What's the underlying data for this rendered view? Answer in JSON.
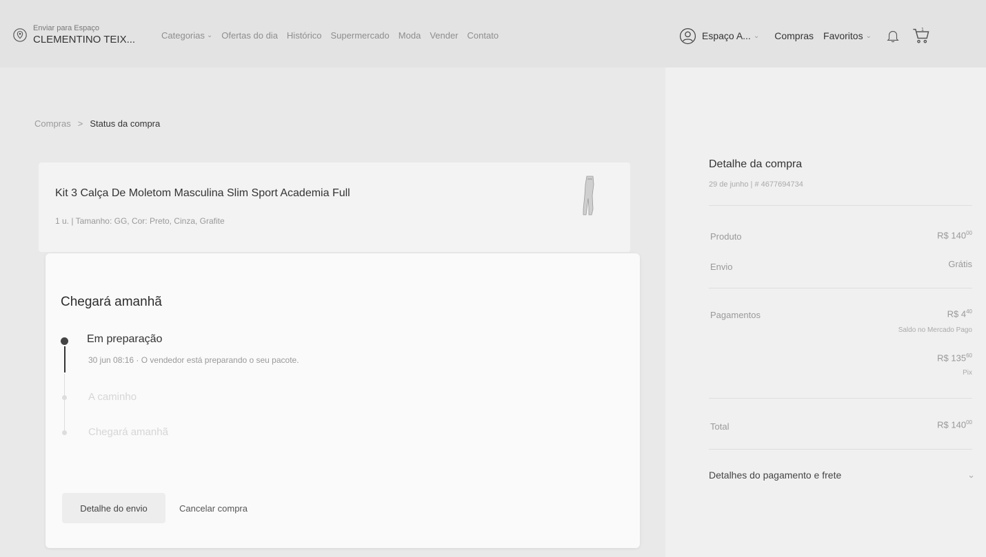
{
  "header": {
    "location_small": "Enviar para Espaço",
    "location_big": "CLEMENTINO TEIX...",
    "nav": [
      {
        "label": "Categorias",
        "dropdown": true
      },
      {
        "label": "Ofertas do dia"
      },
      {
        "label": "Histórico"
      },
      {
        "label": "Supermercado"
      },
      {
        "label": "Moda"
      },
      {
        "label": "Vender"
      },
      {
        "label": "Contato"
      }
    ],
    "account_label": "Espaço A...",
    "purchases_label": "Compras",
    "favorites_label": "Favoritos"
  },
  "breadcrumb": {
    "parent": "Compras",
    "separator": ">",
    "current": "Status da compra"
  },
  "product": {
    "title": "Kit 3 Calça De Moletom Masculina Slim Sport Academia Full",
    "details": "1 u. | Tamanho: GG, Cor: Preto, Cinza, Grafite"
  },
  "status": {
    "title": "Chegará amanhã",
    "steps": [
      {
        "label": "Em preparação",
        "desc": "30 jun 08:16 · O vendedor está preparando o seu pacote.",
        "active": true
      },
      {
        "label": "A caminho",
        "active": false
      },
      {
        "label": "Chegará amanhã",
        "active": false
      }
    ],
    "detail_button": "Detalhe do envio",
    "cancel_button": "Cancelar compra"
  },
  "summary": {
    "title": "Detalhe da compra",
    "subtitle": "29 de junho | # 4677694734",
    "product_label": "Produto",
    "product_value": "R$ 140",
    "product_cents": "00",
    "shipping_label": "Envio",
    "shipping_value": "Grátis",
    "payments_label": "Pagamentos",
    "payment_1_value": "R$ 4",
    "payment_1_cents": "40",
    "payment_1_note": "Saldo no Mercado Pago",
    "payment_2_value": "R$ 135",
    "payment_2_cents": "60",
    "payment_2_note": "Pix",
    "total_label": "Total",
    "total_value": "R$ 140",
    "total_cents": "00",
    "expand_label": "Detalhes do pagamento e frete"
  }
}
